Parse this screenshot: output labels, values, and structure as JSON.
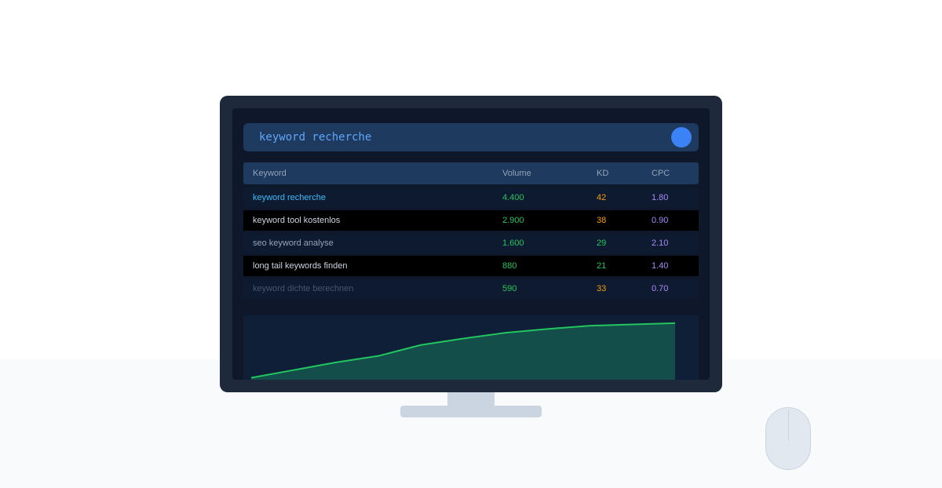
{
  "search": {
    "query": "keyword recherche"
  },
  "table": {
    "headers": {
      "keyword": "Keyword",
      "volume": "Volume",
      "kd": "KD",
      "cpc": "CPC"
    },
    "rows": [
      {
        "keyword": "keyword recherche",
        "volume": "4.400",
        "kd": "42",
        "cpc": "1.80",
        "bg": "#0e1a2f",
        "kw_color": "#38bdf8",
        "kd_color": "#f59e0b"
      },
      {
        "keyword": "keyword tool kostenlos",
        "volume": "2.900",
        "kd": "38",
        "cpc": "0.90",
        "bg": "#000000",
        "kw_color": "#cbd5e1",
        "kd_color": "#f59e0b"
      },
      {
        "keyword": "seo keyword analyse",
        "volume": "1.600",
        "kd": "29",
        "cpc": "2.10",
        "bg": "#0e1a2f",
        "kw_color": "#94a3b8",
        "kd_color": "#22c55e"
      },
      {
        "keyword": "long tail keywords finden",
        "volume": "880",
        "kd": "21",
        "cpc": "1.40",
        "bg": "#000000",
        "kw_color": "#cbd5e1",
        "kd_color": "#22c55e"
      },
      {
        "keyword": "keyword dichte berechnen",
        "volume": "590",
        "kd": "33",
        "cpc": "0.70",
        "bg": "#0e1a2f",
        "kw_color": "#475569",
        "kd_color": "#f59e0b"
      }
    ]
  },
  "colors": {
    "volume": "#22c55e",
    "cpc": "#a78bfa",
    "line": "#22c55e",
    "area": "#134e4a"
  },
  "chart_data": {
    "type": "area",
    "title": "",
    "xlabel": "",
    "ylabel": "",
    "series": [
      {
        "values": [
          3,
          15,
          27,
          37,
          54,
          64,
          73,
          79,
          84,
          86,
          88
        ]
      }
    ],
    "ylim": [
      0,
      100
    ],
    "grid": false,
    "legend": "none"
  }
}
